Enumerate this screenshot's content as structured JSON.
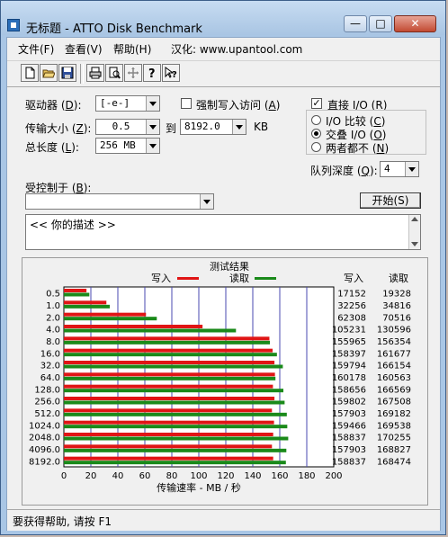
{
  "window": {
    "title": "无标题 - ATTO Disk Benchmark",
    "controls": {
      "minimize": "—",
      "maximize": "□",
      "close": "✕"
    }
  },
  "menu": [
    {
      "label": "文件(F)"
    },
    {
      "label": "查看(V)"
    },
    {
      "label": "帮助(H)"
    },
    {
      "label": "汉化: www.upantool.com"
    }
  ],
  "toolbar": {
    "buttons": [
      {
        "name": "new-icon"
      },
      {
        "name": "open-icon"
      },
      {
        "name": "save-icon"
      },
      {
        "name": "print-icon"
      },
      {
        "name": "print-preview-icon"
      },
      {
        "name": "move-icon"
      },
      {
        "name": "help-icon"
      },
      {
        "name": "context-help-icon"
      }
    ]
  },
  "settings": {
    "drive_label": "驱动器",
    "drive_key": "D",
    "drive_value": "[-e-]",
    "force_write_label": "强制写入访问",
    "force_write_key": "A",
    "force_write_checked": false,
    "direct_io_label": "直接 I/O",
    "direct_io_key": "R",
    "direct_io_checked": true,
    "transfer_label": "传输大小",
    "transfer_key": "Z",
    "transfer_from": "0.5",
    "to_label": "到",
    "transfer_to": "8192.0",
    "unit": "KB",
    "total_label": "总长度",
    "total_key": "L",
    "total_value": "256 MB",
    "io_options": [
      {
        "label": "I/O 比较",
        "key": "C",
        "selected": false
      },
      {
        "label": "交叠 I/O",
        "key": "O",
        "selected": true
      },
      {
        "label": "两者都不",
        "key": "N",
        "selected": false
      }
    ],
    "queue_label": "队列深度",
    "queue_key": "Q",
    "queue_value": "4",
    "controlled_by_label": "受控制于",
    "controlled_by_key": "B",
    "controlled_by_value": "",
    "start_button": "开始(S)",
    "description": "<<  你的描述   >>"
  },
  "results": {
    "title": "测试结果",
    "legend_write": "写入",
    "legend_read": "读取",
    "col_write": "写入",
    "col_read": "读取",
    "axis_label": "传输速率 - MB / 秒"
  },
  "colors": {
    "write": "#e01515",
    "read": "#1a8a1a",
    "titlebar": "#a9c6e5"
  },
  "chart_data": {
    "type": "bar",
    "orientation": "horizontal",
    "title": "测试结果",
    "xlabel": "传输速率 - MB / 秒",
    "xlim": [
      0,
      200
    ],
    "xticks": [
      0,
      20,
      40,
      60,
      80,
      100,
      120,
      140,
      160,
      180,
      200
    ],
    "categories": [
      "0.5",
      "1.0",
      "2.0",
      "4.0",
      "8.0",
      "16.0",
      "32.0",
      "64.0",
      "128.0",
      "256.0",
      "512.0",
      "1024.0",
      "2048.0",
      "4096.0",
      "8192.0"
    ],
    "series": [
      {
        "name": "写入",
        "values": [
          17152,
          32256,
          62308,
          105231,
          155965,
          158397,
          159794,
          160178,
          158656,
          159802,
          157903,
          159466,
          158837,
          157903,
          158837
        ]
      },
      {
        "name": "读取",
        "values": [
          19328,
          34816,
          70516,
          130596,
          156354,
          161677,
          166154,
          160563,
          166569,
          167508,
          169182,
          169538,
          170255,
          168827,
          168474
        ]
      }
    ],
    "value_unit_note": "KB/s"
  },
  "status": {
    "text": "要获得帮助, 请按 F1"
  }
}
